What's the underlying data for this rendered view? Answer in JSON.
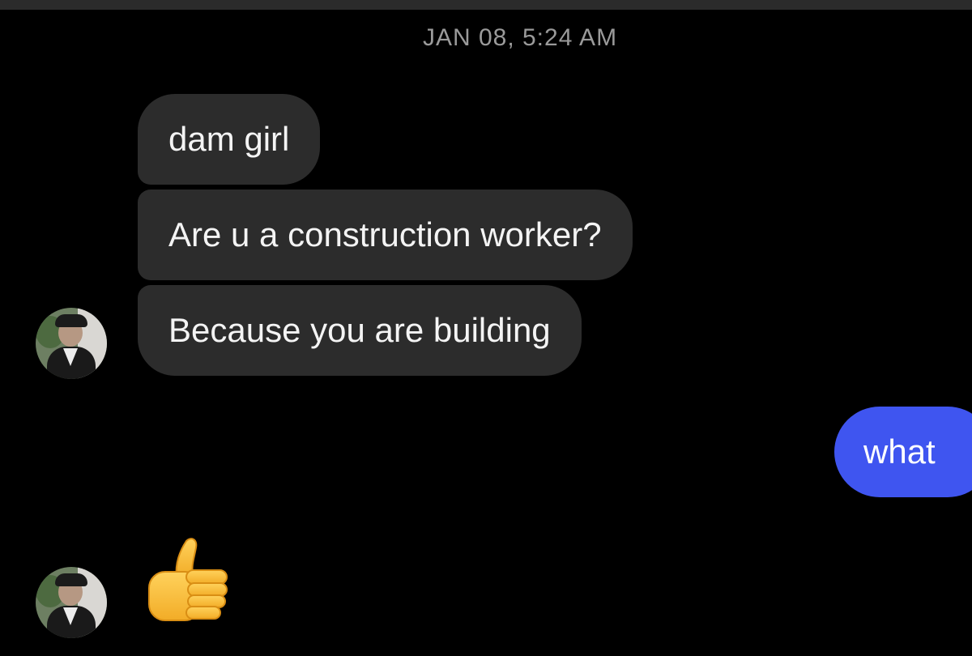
{
  "conversation": {
    "timestamp": "JAN 08, 5:24 AM",
    "incoming_messages": [
      "dam girl",
      "Are u a construction worker?",
      "Because you are building"
    ],
    "outgoing_messages": [
      "what"
    ],
    "reaction": {
      "icon": "thumbs-up-icon"
    }
  },
  "colors": {
    "background": "#000000",
    "incoming_bubble": "#2c2c2c",
    "outgoing_bubble": "#3f55f0",
    "timestamp_text": "#9a9a9a"
  }
}
